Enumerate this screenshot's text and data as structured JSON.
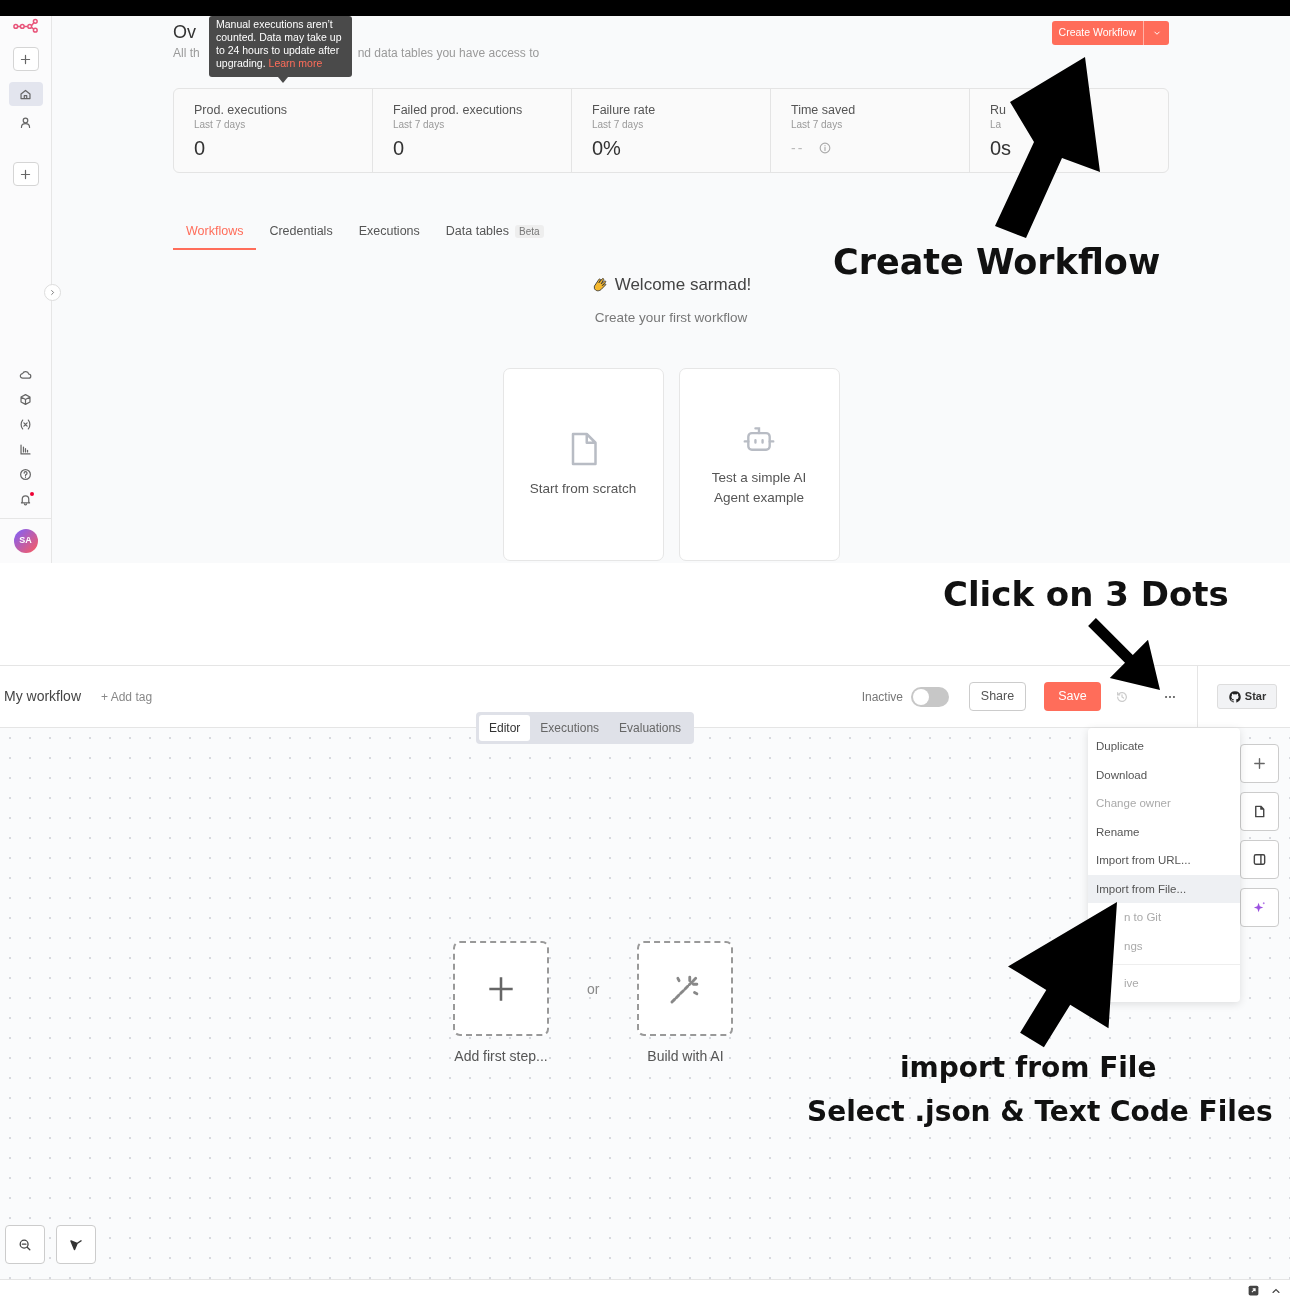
{
  "upper_screen": {
    "sidebar": {
      "nav": [
        {
          "kind": "home",
          "selected": true
        },
        {
          "kind": "user",
          "selected": false
        }
      ],
      "notifications_unread": true,
      "avatar": "SA"
    },
    "tooltip": {
      "text": "Manual executions aren’t counted. Data may take up to 24 hours to update after upgrading.",
      "link": "Learn more"
    },
    "title": "Ov",
    "subtitle_parts": [
      "All th",
      "nd data tables you have access to"
    ],
    "create_button": "Create Workflow",
    "stats": [
      {
        "label": "Prod. executions",
        "sublabel": "Last 7 days",
        "value": "0",
        "info": false
      },
      {
        "label": "Failed prod. executions",
        "sublabel": "Last 7 days",
        "value": "0",
        "info": false
      },
      {
        "label": "Failure rate",
        "sublabel": "Last 7 days",
        "value": "0%",
        "info": false
      },
      {
        "label": "Time saved",
        "sublabel": "Last 7 days",
        "value": "--",
        "info": true
      },
      {
        "label": "Ru",
        "sublabel": "La",
        "value": "0s",
        "info": false
      }
    ],
    "tabs": [
      {
        "label": "Workflows",
        "selected": true
      },
      {
        "label": "Credentials",
        "selected": false
      },
      {
        "label": "Executions",
        "selected": false
      },
      {
        "label": "Data tables",
        "selected": false,
        "badge": "Beta"
      }
    ],
    "welcome": {
      "title": "Welcome sarmad!",
      "subtitle": "Create your first workflow"
    },
    "start_cards": [
      {
        "kind": "file",
        "label": "Start from scratch"
      },
      {
        "kind": "robot",
        "label": "Test a simple AI Agent example"
      }
    ],
    "annotation": "Create Workflow"
  },
  "annotation_middle": "Click on 3 Dots",
  "lower_screen": {
    "workflow_name": "My workflow",
    "add_tag": "+ Add tag",
    "active_toggle": {
      "label": "Inactive",
      "on": false
    },
    "share_button": "Share",
    "save_button": "Save",
    "star_button": "Star",
    "view_tabs": [
      {
        "label": "Editor",
        "selected": true
      },
      {
        "label": "Executions",
        "selected": false
      },
      {
        "label": "Evaluations",
        "selected": false
      }
    ],
    "menu": [
      {
        "label": "Duplicate",
        "disabled": false,
        "selected": false,
        "kind": "item"
      },
      {
        "label": "Download",
        "disabled": false,
        "selected": false,
        "kind": "item"
      },
      {
        "label": "Change owner",
        "disabled": true,
        "selected": false,
        "kind": "item"
      },
      {
        "label": "Rename",
        "disabled": false,
        "selected": false,
        "kind": "item"
      },
      {
        "label": "Import from URL...",
        "disabled": false,
        "selected": false,
        "kind": "item"
      },
      {
        "label": "Import from File...",
        "disabled": false,
        "selected": true,
        "kind": "item"
      },
      {
        "label": "n to Git",
        "disabled": true,
        "selected": false,
        "kind": "partial"
      },
      {
        "label": "ngs",
        "disabled": true,
        "selected": false,
        "kind": "partial"
      },
      {
        "label": "ive",
        "disabled": true,
        "selected": false,
        "kind": "partial_divided"
      }
    ],
    "canvas": {
      "add_step": "Add first step...",
      "separator": "or",
      "build_ai": "Build with AI"
    },
    "annotation": [
      "import from File",
      "Select .json & Text Code Files"
    ]
  }
}
